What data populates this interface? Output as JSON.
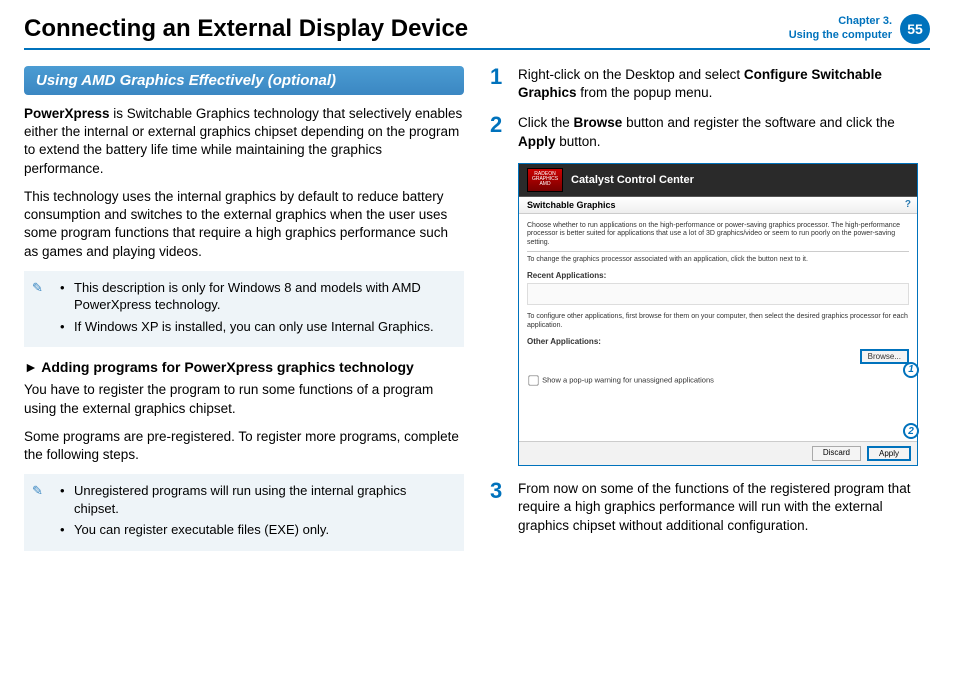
{
  "header": {
    "title": "Connecting an External Display Device",
    "chapter_line1": "Chapter 3.",
    "chapter_line2": "Using the computer",
    "page": "55"
  },
  "left": {
    "section_bar": "Using AMD Graphics Effectively (optional)",
    "p1_bold": "PowerXpress",
    "p1_rest": " is Switchable Graphics technology that selectively enables either the internal or external graphics chipset depending on the program to extend the battery life time while maintaining the graphics performance.",
    "p2": "This technology uses the internal graphics by default to reduce battery consumption and switches to the external graphics when the user uses some program functions that require a high graphics performance such as games and playing videos.",
    "note1": {
      "b1": "This description is only for Windows 8 and models with AMD PowerXpress technology.",
      "b2": "If Windows XP is installed, you can only use Internal Graphics."
    },
    "sub_head": "► Adding programs for PowerXpress graphics technology",
    "p3": "You have to register the program to run some functions of a program using the external graphics chipset.",
    "p4": "Some programs are pre-registered. To register more programs, complete the following steps.",
    "note2": {
      "b1": "Unregistered programs will run using the internal graphics chipset.",
      "b2": "You can register executable files (EXE) only."
    }
  },
  "right": {
    "step1": {
      "num": "1",
      "pre": "Right-click on the Desktop and select ",
      "bold": "Configure Switchable Graphics",
      "post": " from the popup menu."
    },
    "step2": {
      "num": "2",
      "pre": "Click the ",
      "bold1": "Browse",
      "mid": " button and register the software and click the ",
      "bold2": "Apply",
      "post": " button."
    },
    "step3": {
      "num": "3",
      "txt": "From now on some of the functions of the registered program that require a high graphics performance will run with the external graphics chipset without additional configuration."
    }
  },
  "shot": {
    "badge": "RADEON GRAPHICS AMD",
    "title": "Catalyst Control Center",
    "sub": "Switchable Graphics",
    "help": "?",
    "desc1": "Choose whether to run applications on the high-performance or power-saving graphics processor. The high-performance processor is better suited for applications that use a lot of 3D graphics/video or seem to run poorly on the power-saving setting.",
    "desc2": "To change the graphics processor associated with an application, click the button next to it.",
    "label_recent": "Recent Applications:",
    "desc3": "To configure other applications, first browse for them on your computer, then select the desired graphics processor for each application.",
    "label_other": "Other Applications:",
    "browse": "Browse...",
    "chk": "Show a pop-up warning for unassigned applications",
    "discard": "Discard",
    "apply": "Apply",
    "callout1": "1",
    "callout2": "2"
  }
}
